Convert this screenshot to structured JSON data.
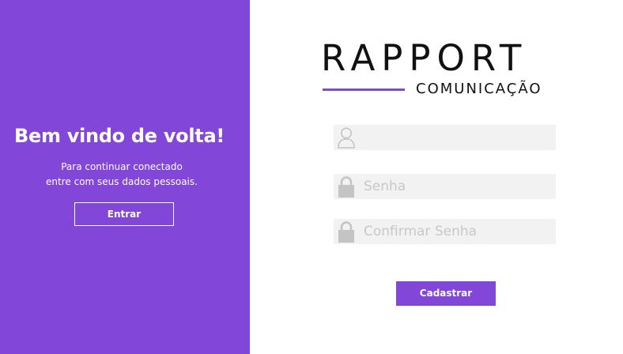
{
  "welcome": {
    "title": "Bem vindo de volta!",
    "line1": "Para continuar conectado",
    "line2": "entre com seus dados pessoais.",
    "enter_label": "Entrar"
  },
  "logo": {
    "word": "RAPPORT",
    "sub": "COMUNICAÇÃO"
  },
  "form": {
    "user_placeholder": "",
    "password_placeholder": "Senha",
    "confirm_placeholder": "Confirmar Senha",
    "register_label": "Cadastrar",
    "icons": {
      "user": "user-icon",
      "password": "lock-icon",
      "confirm": "lock-icon"
    }
  },
  "colors": {
    "accent": "#8246d8",
    "field_bg": "#f2f2f2",
    "icon": "#c4c4c4"
  }
}
